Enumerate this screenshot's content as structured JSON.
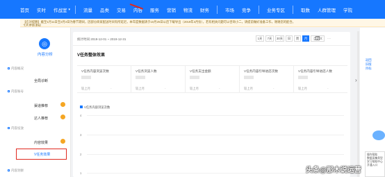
{
  "nav": {
    "items": [
      "首页",
      "实时",
      "作战室",
      "流量",
      "品类",
      "交易",
      "内容",
      "服务",
      "营销",
      "物流",
      "财务",
      "市场",
      "竞争",
      "业务专区",
      "取数",
      "人群管理",
      "学院"
    ],
    "active": "内容"
  },
  "notice": {
    "line1": "【应对提醒】截至1月11日至2月3日为春节期间，因部分商家配送时间有所延迟，本年度数据请于10月25日以后下载导出（2019年3月份），若有相关问题可以咨询小二，请提前做好准备工作，谢谢您的配合。",
    "line2": "卡片更新须知"
  },
  "sidebar": {
    "title": "内容分析",
    "sections": [
      {
        "label": "内容概况",
        "items": [
          "全局诊断"
        ]
      },
      {
        "label": "内容账号",
        "items": [
          "渠道推荐",
          "达人推荐"
        ]
      },
      {
        "label": "内容投放",
        "items": [
          "内容效果",
          "V任务效果"
        ]
      },
      {
        "label": "内容洞察",
        "items": []
      }
    ],
    "selected": "V任务效果"
  },
  "datebar": {
    "range": "统计时间 2019-12-01 ~ 2019-12-31",
    "buttons": [
      "1天",
      "7天",
      "30天",
      "日",
      "周",
      "月",
      "自定义"
    ],
    "active": "月"
  },
  "section_title": "V任务整体效果",
  "metrics": [
    {
      "name": "V任务内容浏览次数",
      "compare": "较上月",
      "delta": "-"
    },
    {
      "name": "V任务浏览人数",
      "compare": "较上月",
      "delta": "-"
    },
    {
      "name": "V任务支出金额",
      "compare": "较上月",
      "delta": "-"
    },
    {
      "name": "V任务内容引导进店次数",
      "compare": "较上月",
      "delta": "-"
    },
    {
      "name": "V任务内容引导进店人数",
      "compare": "较上月",
      "delta": "-"
    }
  ],
  "chart_data": {
    "type": "line",
    "series": [
      {
        "name": "V任务内容浏览次数",
        "values": []
      }
    ],
    "ylim": [
      0,
      4
    ],
    "yticks": [
      "4",
      "3",
      "2",
      "1"
    ]
  },
  "right_panel": {
    "links": [
      "返回",
      "旧版",
      "目标"
    ]
  },
  "help": {
    "title": "操作帮助",
    "body": "数据采集类型 学习帮助中心 开通入口"
  },
  "watermark": "头条@那木说运营"
}
